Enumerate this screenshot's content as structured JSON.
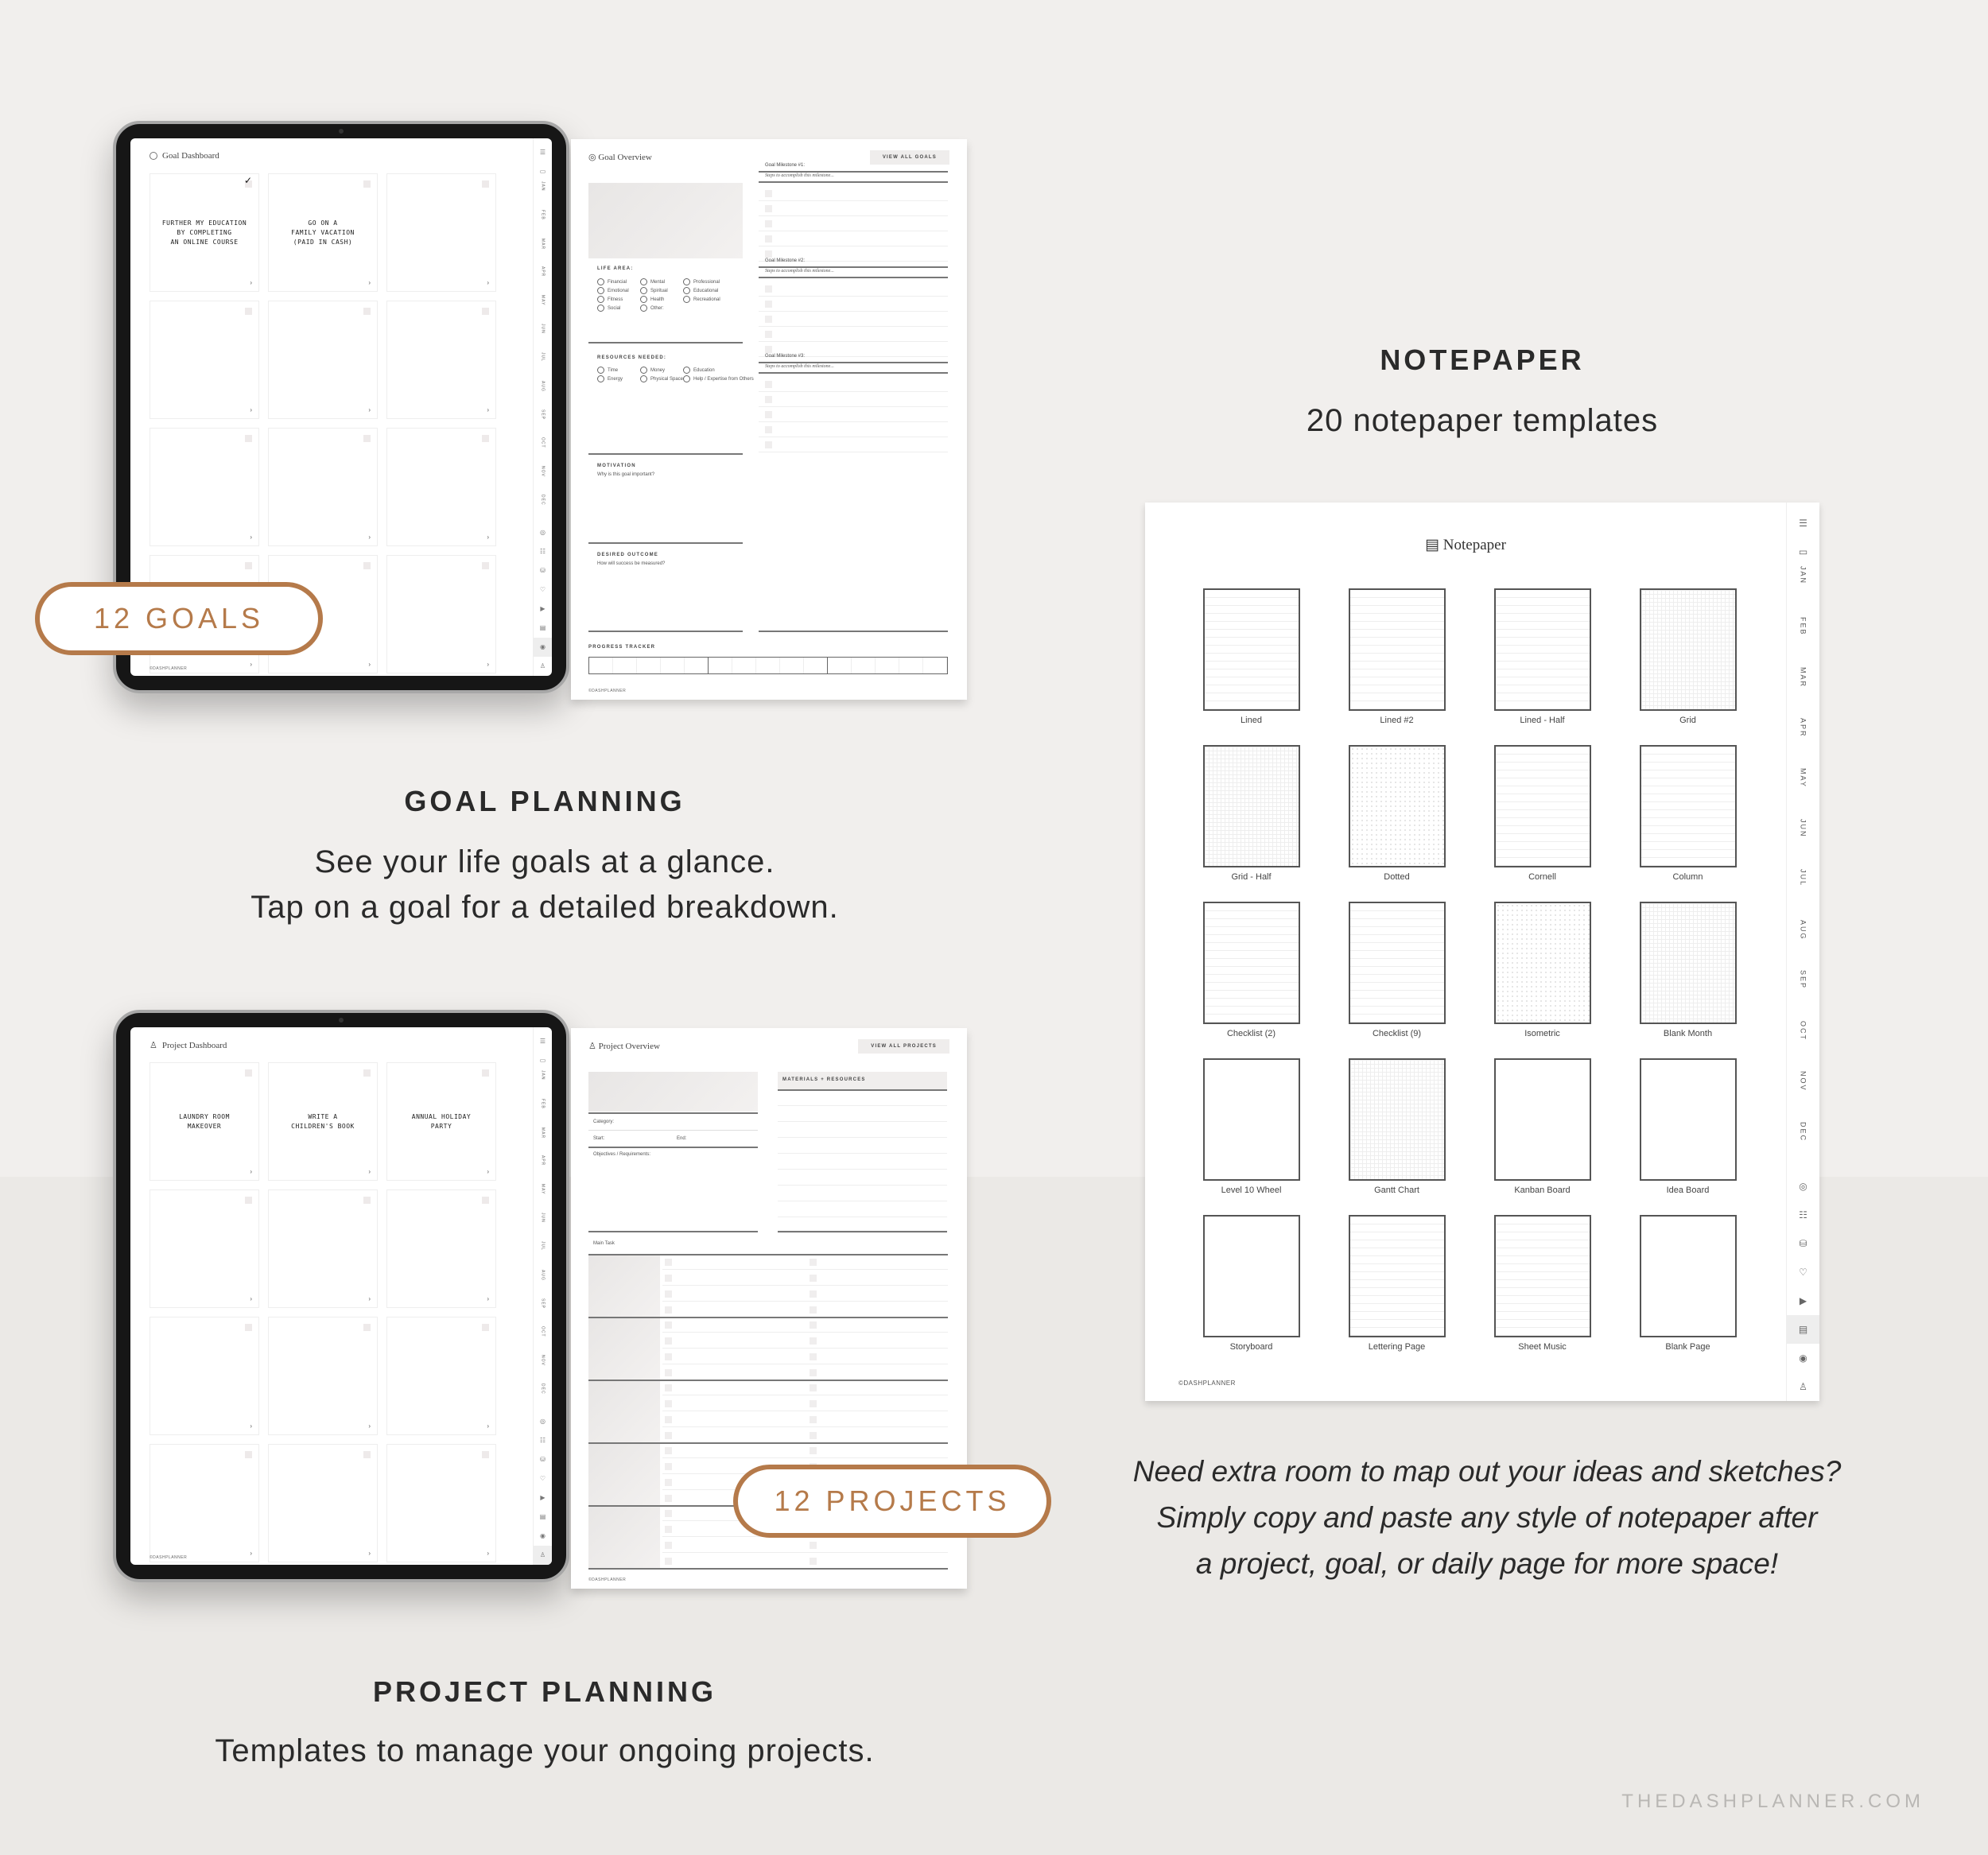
{
  "goal_section": {
    "heading": "GOAL PLANNING",
    "line1": "See your life goals at a glance.",
    "line2": "Tap on a goal for a detailed breakdown.",
    "badge": "12 GOALS",
    "dashboard": {
      "title": "Goal Dashboard",
      "icon": "target-icon",
      "cards": [
        {
          "text": "FURTHER MY EDUCATION\nBY COMPLETING\nAN ONLINE COURSE",
          "checked": true
        },
        {
          "text": "GO ON A\nFAMILY VACATION\n(PAID IN CASH)",
          "checked": false
        },
        {
          "text": "",
          "checked": false
        },
        {
          "text": "",
          "checked": false
        },
        {
          "text": "",
          "checked": false
        },
        {
          "text": "",
          "checked": false
        },
        {
          "text": "",
          "checked": false
        },
        {
          "text": "",
          "checked": false
        },
        {
          "text": "",
          "checked": false
        },
        {
          "text": "",
          "checked": false
        },
        {
          "text": "",
          "checked": false
        },
        {
          "text": "",
          "checked": false
        }
      ],
      "footer": "©DASHPLANNER"
    },
    "overview": {
      "title": "Goal Overview",
      "button": "VIEW ALL GOALS",
      "life_area_label": "LIFE AREA:",
      "life_areas": [
        "Financial",
        "Mental",
        "Professional",
        "Emotional",
        "Spiritual",
        "Educational",
        "Fitness",
        "Health",
        "Recreational",
        "Social",
        "Other:"
      ],
      "resources_label": "RESOURCES NEEDED:",
      "resources": [
        "Time",
        "Money",
        "Education",
        "Energy",
        "Physical Space",
        "Help / Expertise from Others"
      ],
      "motivation_label": "MOTIVATION",
      "motivation_q": "Why is this goal important?",
      "outcome_label": "DESIRED OUTCOME",
      "outcome_q": "How will success be measured?",
      "progress_label": "PROGRESS TRACKER",
      "milestones": [
        {
          "label": "Goal Milestone #1:",
          "steps": "Steps to accomplish this milestone..."
        },
        {
          "label": "Goal Milestone #2:",
          "steps": "Steps to accomplish this milestone..."
        },
        {
          "label": "Goal Milestone #3:",
          "steps": "Steps to accomplish this milestone..."
        }
      ],
      "footer": "©DASHPLANNER"
    }
  },
  "project_section": {
    "heading": "PROJECT PLANNING",
    "line1": "Templates to manage your ongoing projects.",
    "badge": "12 PROJECTS",
    "dashboard": {
      "title": "Project Dashboard",
      "icon": "project-icon",
      "cards": [
        {
          "text": "LAUNDRY ROOM\nMAKEOVER"
        },
        {
          "text": "WRITE A\nCHILDREN'S BOOK"
        },
        {
          "text": "ANNUAL HOLIDAY\nPARTY"
        },
        {
          "text": ""
        },
        {
          "text": ""
        },
        {
          "text": ""
        },
        {
          "text": ""
        },
        {
          "text": ""
        },
        {
          "text": ""
        },
        {
          "text": ""
        },
        {
          "text": ""
        },
        {
          "text": ""
        }
      ],
      "footer": "©DASHPLANNER"
    },
    "overview": {
      "title": "Project Overview",
      "button": "VIEW ALL PROJECTS",
      "category": "Category:",
      "start": "Start:",
      "end": "End:",
      "objectives": "Objectives / Requirements:",
      "materials": "MATERIALS + RESOURCES",
      "main_task": "Main Task",
      "footer": "©DASHPLANNER"
    }
  },
  "notepaper_section": {
    "heading": "NOTEPAPER",
    "subheading": "20 notepaper templates",
    "page_title": "Notepaper",
    "templates": [
      {
        "name": "Lined",
        "style": "lined"
      },
      {
        "name": "Lined #2",
        "style": "lined"
      },
      {
        "name": "Lined - Half",
        "style": "lined"
      },
      {
        "name": "Grid",
        "style": "grid"
      },
      {
        "name": "Grid - Half",
        "style": "grid"
      },
      {
        "name": "Dotted",
        "style": "dot"
      },
      {
        "name": "Cornell",
        "style": "lined"
      },
      {
        "name": "Column",
        "style": "lined"
      },
      {
        "name": "Checklist (2)",
        "style": "lined"
      },
      {
        "name": "Checklist (9)",
        "style": "lined"
      },
      {
        "name": "Isometric",
        "style": "dot"
      },
      {
        "name": "Blank Month",
        "style": "grid"
      },
      {
        "name": "Level 10 Wheel",
        "style": "blank"
      },
      {
        "name": "Gantt Chart",
        "style": "grid"
      },
      {
        "name": "Kanban Board",
        "style": "blank"
      },
      {
        "name": "Idea Board",
        "style": "blank"
      },
      {
        "name": "Storyboard",
        "style": "blank"
      },
      {
        "name": "Lettering Page",
        "style": "lined"
      },
      {
        "name": "Sheet Music",
        "style": "lined"
      },
      {
        "name": "Blank Page",
        "style": "blank"
      }
    ],
    "footer": "©DASHPLANNER",
    "caption": [
      "Need extra room to map out your ideas and sketches?",
      "Simply copy and paste any style of notepaper after",
      "a project, goal, or daily page for more space!"
    ]
  },
  "side_tabs": {
    "months": [
      "JAN",
      "FEB",
      "MAR",
      "APR",
      "MAY",
      "JUN",
      "JUL",
      "AUG",
      "SEP",
      "OCT",
      "NOV",
      "DEC"
    ],
    "top_icons": [
      "☰",
      "▭"
    ],
    "bottom_icons": [
      "◎",
      "☷",
      "⛁",
      "♡",
      "▶",
      "▤",
      "◉",
      "♙"
    ]
  },
  "website": "THEDASHPLANNER.COM",
  "colors": {
    "accent": "#b57a4a",
    "background": "#f1efed"
  }
}
